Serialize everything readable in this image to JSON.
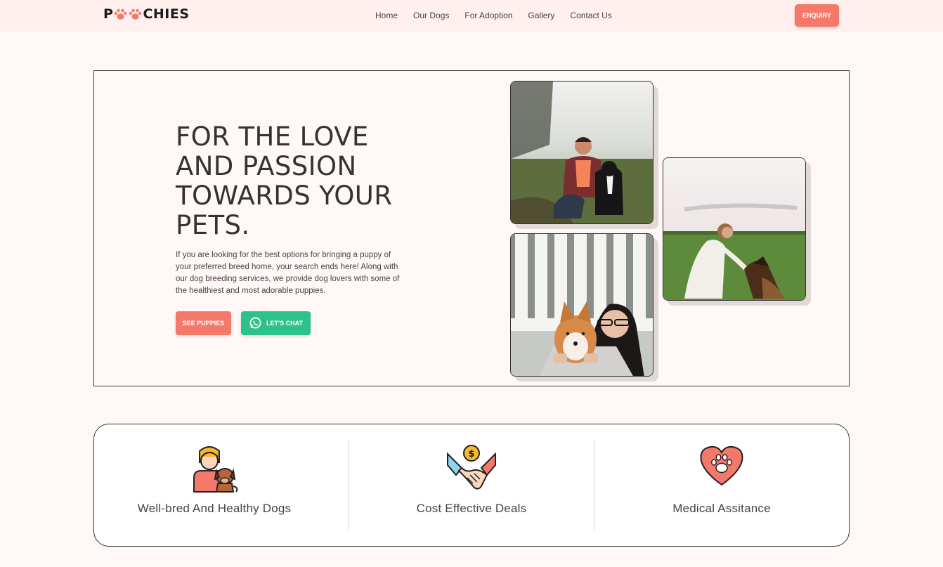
{
  "brand": {
    "logo_text_p": "P",
    "logo_text_rest": "CHIES",
    "accent": "#f4796b",
    "chat_green": "#2ec28b"
  },
  "nav": {
    "items": [
      {
        "label": "Home"
      },
      {
        "label": "Our Dogs"
      },
      {
        "label": "For Adoption"
      },
      {
        "label": "Gallery"
      },
      {
        "label": "Contact Us"
      }
    ],
    "enquiry_label": "ENQUIRY"
  },
  "hero": {
    "title": "FOR THE LOVE AND PASSION TOWARDS YOUR PETS.",
    "description": "If you are looking for the best options for bringing a puppy of your preferred breed home, your search ends here! Along with our dog breeding services, we provide dog lovers with some of the healthiest and most adorable puppies.",
    "see_puppies_label": "SEE PUPPIES",
    "chat_label": "LET'S CHAT",
    "chat_icon": "whatsapp-icon"
  },
  "photos": [
    {
      "icon": "man-with-dog-photo"
    },
    {
      "icon": "woman-with-dog-field-photo"
    },
    {
      "icon": "woman-hugging-shiba-photo"
    }
  ],
  "features": [
    {
      "label": "Well-bred And Healthy Dogs",
      "icon": "boy-with-dog-icon"
    },
    {
      "label": "Cost Effective Deals",
      "icon": "handshake-dollar-icon"
    },
    {
      "label": "Medical Assitance",
      "icon": "heart-paw-icon"
    }
  ]
}
